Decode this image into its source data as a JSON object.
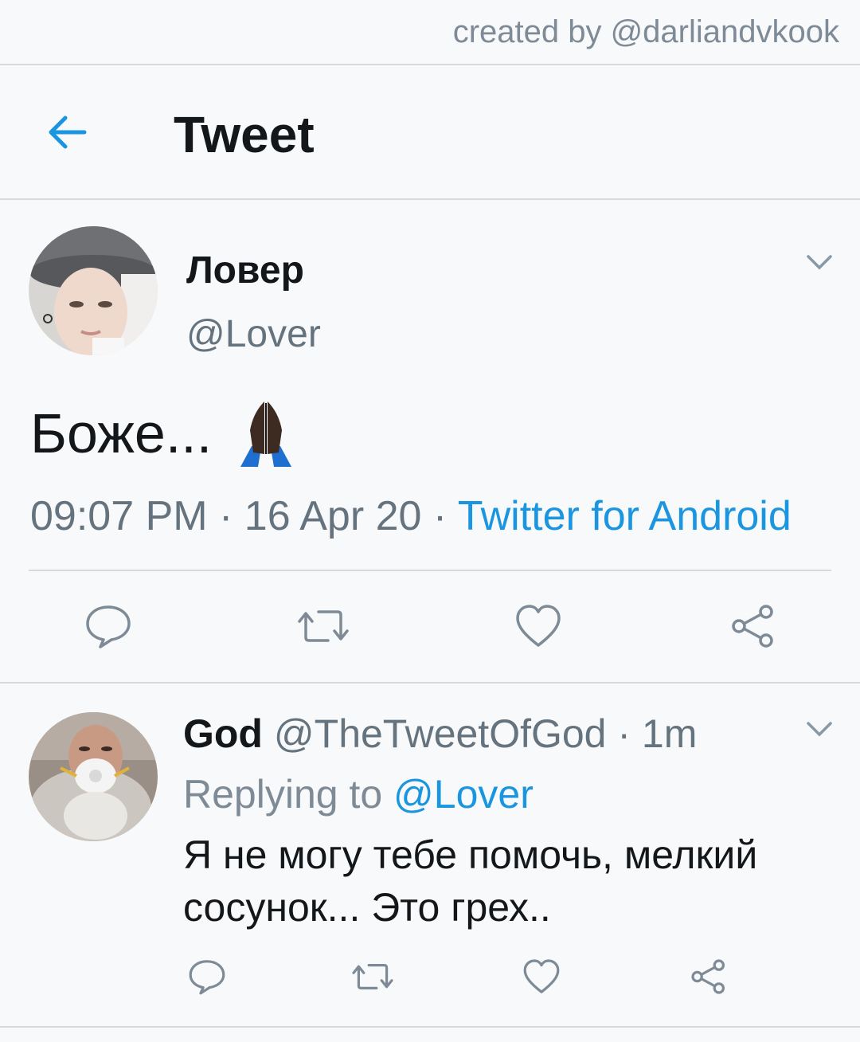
{
  "watermark": "created by @darliandvkook",
  "header": {
    "title": "Tweet",
    "back_icon": "arrow-left-icon"
  },
  "tweet": {
    "display_name": "Ловер",
    "handle": "@Lover",
    "text": "Боже...",
    "emoji": "🙏🏿",
    "time": "09:07 PM",
    "sep1": " · ",
    "date": "16 Apr 20",
    "sep2": " · ",
    "source": "Twitter for Android"
  },
  "reply": {
    "display_name": "God",
    "handle": "@TheTweetOfGod",
    "age": " · 1m",
    "replying_prefix": "Replying to ",
    "replying_to": "@Lover",
    "text": "Я не могу тебе помочь, мелкий сосунок... Это грех.."
  },
  "colors": {
    "accent": "#1a95e0",
    "muted": "#65737e",
    "divider": "#d6dbe0"
  }
}
